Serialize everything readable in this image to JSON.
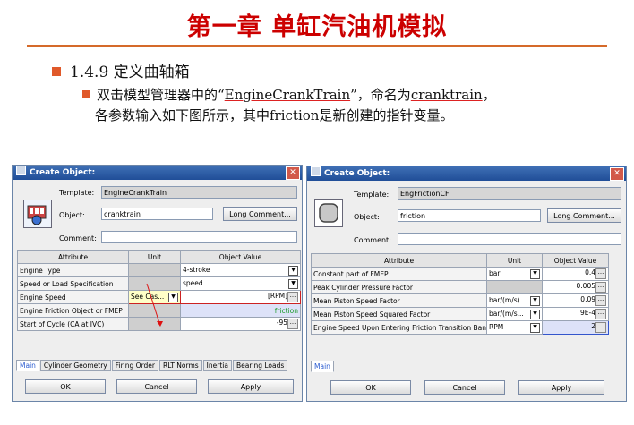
{
  "slide": {
    "title": "第一章 单缸汽油机模拟",
    "bullet1": "1.4.9 定义曲轴箱",
    "bullet2_a": "双击模型管理器中的“",
    "bullet2_link": "EngineCrankTrain",
    "bullet2_b": "”，命名为",
    "bullet2_name": "cranktrain",
    "bullet2_c": "，",
    "bullet2_line2": "各参数输入如下图所示，其中friction是新创建的指针变量。"
  },
  "win_left": {
    "title": "Create Object:",
    "template_label": "Template:",
    "template_value": "EngineCrankTrain",
    "object_label": "Object:",
    "object_value": "cranktrain",
    "long_comment": "Long Comment...",
    "comment_label": "Comment:",
    "headers": [
      "Attribute",
      "Unit",
      "Object Value"
    ],
    "rows": [
      {
        "attr": "Engine Type",
        "unit": "",
        "value": "4-stroke"
      },
      {
        "attr": "Speed or Load Specification",
        "unit": "",
        "value": "speed"
      },
      {
        "attr": "Engine Speed",
        "unit": "See Cas...",
        "value": "[RPM]"
      },
      {
        "attr": "Engine Friction Object or FMEP",
        "unit": "",
        "value": "friction"
      },
      {
        "attr": "Start of Cycle (CA at IVC)",
        "unit": "",
        "value": "-95"
      }
    ],
    "tabs": [
      "Main",
      "Cylinder Geometry",
      "Firing Order",
      "RLT Norms",
      "Inertia",
      "Bearing Loads"
    ],
    "ok": "OK",
    "cancel": "Cancel",
    "apply": "Apply"
  },
  "win_right": {
    "title": "Create Object:",
    "template_label": "Template:",
    "template_value": "EngFrictionCF",
    "object_label": "Object:",
    "object_value": "friction",
    "long_comment": "Long Comment...",
    "comment_label": "Comment:",
    "headers": [
      "Attribute",
      "Unit",
      "Object Value"
    ],
    "rows": [
      {
        "attr": "Constant part of FMEP",
        "unit": "bar",
        "value": "0.4"
      },
      {
        "attr": "Peak Cylinder Pressure Factor",
        "unit": "",
        "value": "0.005"
      },
      {
        "attr": "Mean Piston Speed Factor",
        "unit": "bar/(m/s)",
        "value": "0.09"
      },
      {
        "attr": "Mean Piston Speed Squared Factor",
        "unit": "bar/(m/s...",
        "value": "9E-4"
      },
      {
        "attr": "Engine Speed Upon Entering Friction Transition Band",
        "unit": "RPM",
        "value": "2"
      }
    ],
    "tabs": [
      "Main"
    ],
    "ok": "OK",
    "cancel": "Cancel",
    "apply": "Apply"
  }
}
